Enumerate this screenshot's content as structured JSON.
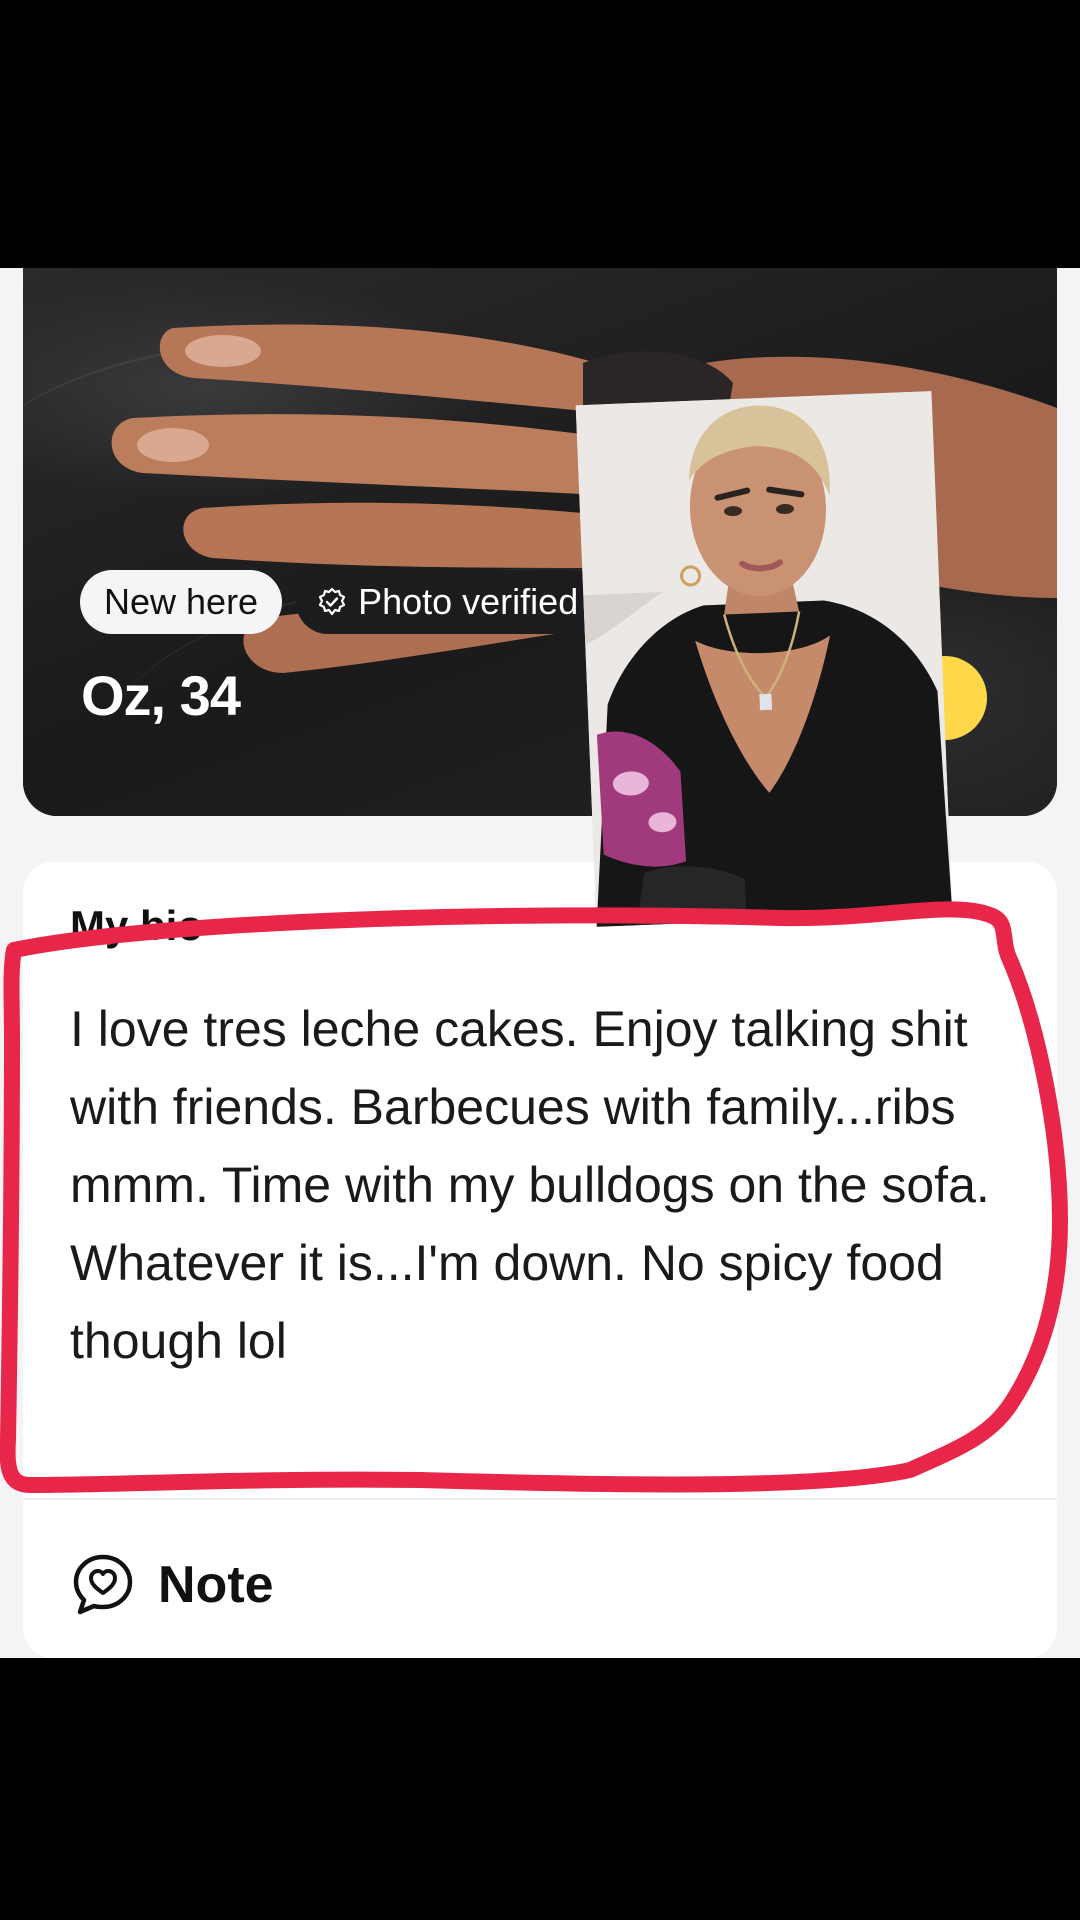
{
  "profile": {
    "badge_new": "New here",
    "badge_verified": "Photo verified",
    "name_age": "Oz, 34"
  },
  "bio": {
    "heading": "My bio",
    "text": "I love tres leche cakes. Enjoy talking shit with friends. Barbecues with family...ribs mmm. Time with my bulldogs on the sofa. Whatever it is...I'm down. No spicy food though lol"
  },
  "note": {
    "label": "Note"
  },
  "icons": {
    "verified": "check-circle-icon",
    "note": "heart-speech-bubble-icon"
  },
  "colors": {
    "annotation": "#e8264a",
    "accent_yellow": "#ffd84a",
    "badge_dark": "#1c1c1e",
    "card_bg": "#ffffff"
  }
}
